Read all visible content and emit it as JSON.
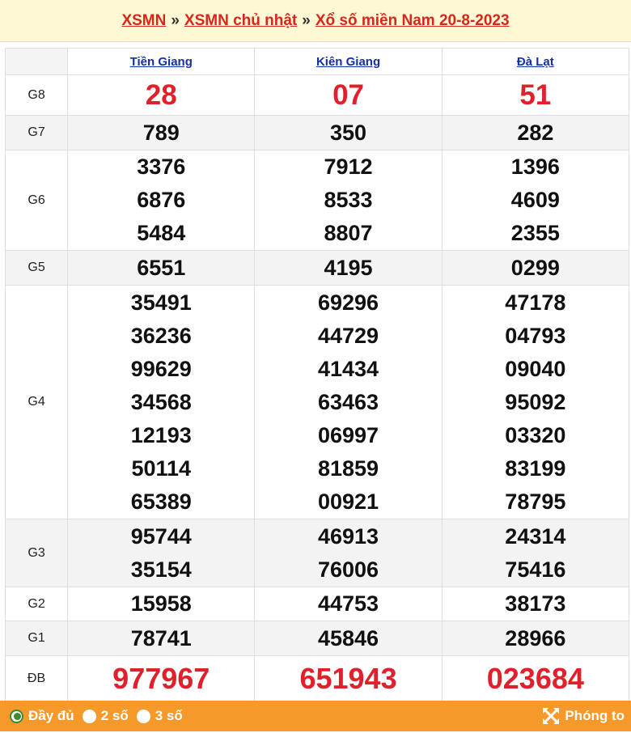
{
  "header": {
    "crumb1": "XSMN",
    "crumb2": "XSMN chủ nhật",
    "crumb3": "Xổ số miền Nam 20-8-2023",
    "sep": "»"
  },
  "provinces": [
    "Tiền Giang",
    "Kiên Giang",
    "Đà Lạt"
  ],
  "prizes": [
    {
      "label": "G8",
      "values": [
        [
          "28"
        ],
        [
          "07"
        ],
        [
          "51"
        ]
      ]
    },
    {
      "label": "G7",
      "values": [
        [
          "789"
        ],
        [
          "350"
        ],
        [
          "282"
        ]
      ]
    },
    {
      "label": "G6",
      "values": [
        [
          "3376",
          "6876",
          "5484"
        ],
        [
          "7912",
          "8533",
          "8807"
        ],
        [
          "1396",
          "4609",
          "2355"
        ]
      ]
    },
    {
      "label": "G5",
      "values": [
        [
          "6551"
        ],
        [
          "4195"
        ],
        [
          "0299"
        ]
      ]
    },
    {
      "label": "G4",
      "values": [
        [
          "35491",
          "36236",
          "99629",
          "34568",
          "12193",
          "50114",
          "65389"
        ],
        [
          "69296",
          "44729",
          "41434",
          "63463",
          "06997",
          "81859",
          "00921"
        ],
        [
          "47178",
          "04793",
          "09040",
          "95092",
          "03320",
          "83199",
          "78795"
        ]
      ]
    },
    {
      "label": "G3",
      "values": [
        [
          "95744",
          "35154"
        ],
        [
          "46913",
          "76006"
        ],
        [
          "24314",
          "75416"
        ]
      ]
    },
    {
      "label": "G2",
      "values": [
        [
          "15958"
        ],
        [
          "44753"
        ],
        [
          "38173"
        ]
      ]
    },
    {
      "label": "G1",
      "values": [
        [
          "78741"
        ],
        [
          "45846"
        ],
        [
          "28966"
        ]
      ]
    },
    {
      "label": "ĐB",
      "values": [
        [
          "977967"
        ],
        [
          "651943"
        ],
        [
          "023684"
        ]
      ]
    }
  ],
  "footer": {
    "options": [
      "Đầy đủ",
      "2 số",
      "3 số"
    ],
    "selected": "Đầy đủ",
    "zoom_label": "Phóng to"
  },
  "colors": {
    "accent_red": "#e0202a",
    "footer_bg": "#f59a2a",
    "link_blue": "#1530a6"
  }
}
